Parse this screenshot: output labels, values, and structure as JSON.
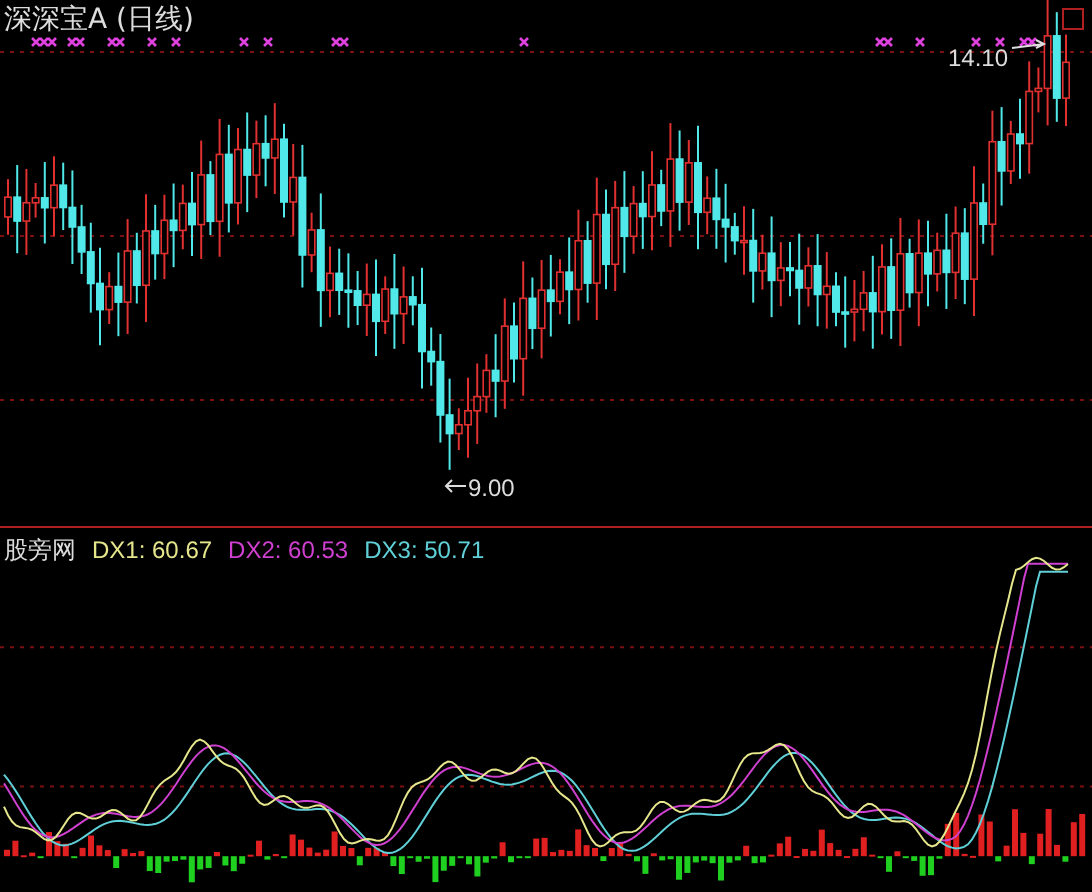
{
  "price_panel": {
    "title": "深深宝A (日线)",
    "high_label": "14.10",
    "low_label": "9.00"
  },
  "indicator_panel": {
    "name": "股旁网",
    "lines": [
      {
        "label": "DX1: 60.67",
        "color": "#e6e68c"
      },
      {
        "label": "DX2: 60.53",
        "color": "#d040d0"
      },
      {
        "label": "DX3: 50.71",
        "color": "#60d0d8"
      }
    ]
  }
}
